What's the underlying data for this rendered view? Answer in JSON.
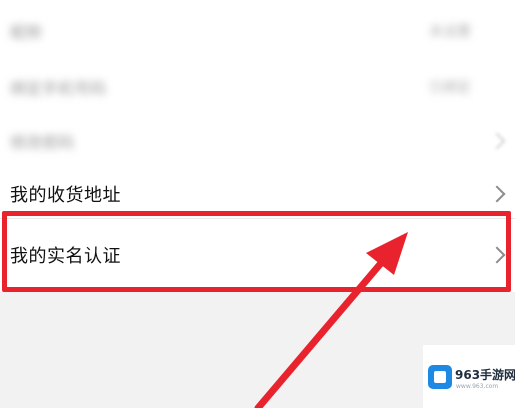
{
  "menu": {
    "blurred_rows": [
      {
        "label": "昵称",
        "value": "未设置"
      },
      {
        "label": "绑定手机号码",
        "value": "已绑定"
      },
      {
        "label": "修改密码"
      }
    ],
    "address_label": "我的收货地址",
    "realname_label": "我的实名认证"
  },
  "watermark": {
    "name": "963手游网",
    "url": "www.963.com"
  },
  "colors": {
    "highlight": "#e8232e",
    "arrow": "#e8232e",
    "watermark_brand": "#1e88e5"
  }
}
